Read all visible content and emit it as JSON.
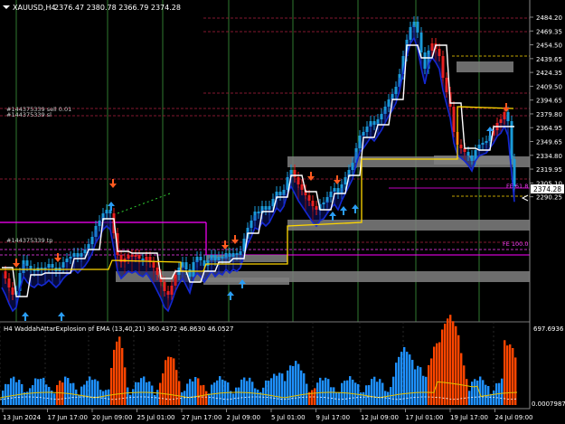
{
  "header": {
    "symbol": "XAUUSD,H4",
    "ohlc": "2376.47 2380.78 2366.79 2374.28"
  },
  "price_axis": {
    "ticks": [
      "2484.20",
      "2469.35",
      "2454.50",
      "2439.65",
      "2424.35",
      "2409.50",
      "2394.65",
      "2379.80",
      "2364.95",
      "2349.65",
      "2334.80",
      "2319.95",
      "2305.10",
      "2290.25"
    ],
    "current_price": "2374.28"
  },
  "time_axis": {
    "ticks": [
      "13 Jun 2024",
      "17 Jun 17:00",
      "20 Jun 09:00",
      "25 Jul 01:00",
      "27 Jun 17:00",
      "2 Jul 09:00",
      "5 Jul 01:00",
      "9 Jul 17:00",
      "12 Jul 09:00",
      "17 Jul 01:00",
      "19 Jul 17:00",
      "24 Jul 09:00"
    ]
  },
  "annotations": {
    "order_sell": "#144375339 sell 0.01",
    "order_sl": "#144375339 sl",
    "order_tp": "#144375339 tp",
    "fib_1": "FE 61.8",
    "fib_2": "FE 100.0"
  },
  "indicator": {
    "title": "H4  WaddahAttarExplosion of EMA (13,40,21) 360.4372 46.8630 46.0527",
    "axis_top": "697.6936",
    "axis_bottom": "0.0007987"
  },
  "colors": {
    "background": "#000000",
    "bull": "#1e90ff",
    "bear": "#ff4500",
    "grid": "#2f7a2f",
    "zone": "#808080",
    "yellow_line": "#ffd700",
    "magenta_line": "#ff00ff",
    "ma_blue": "#1428d2",
    "white_line": "#ffffff"
  }
}
